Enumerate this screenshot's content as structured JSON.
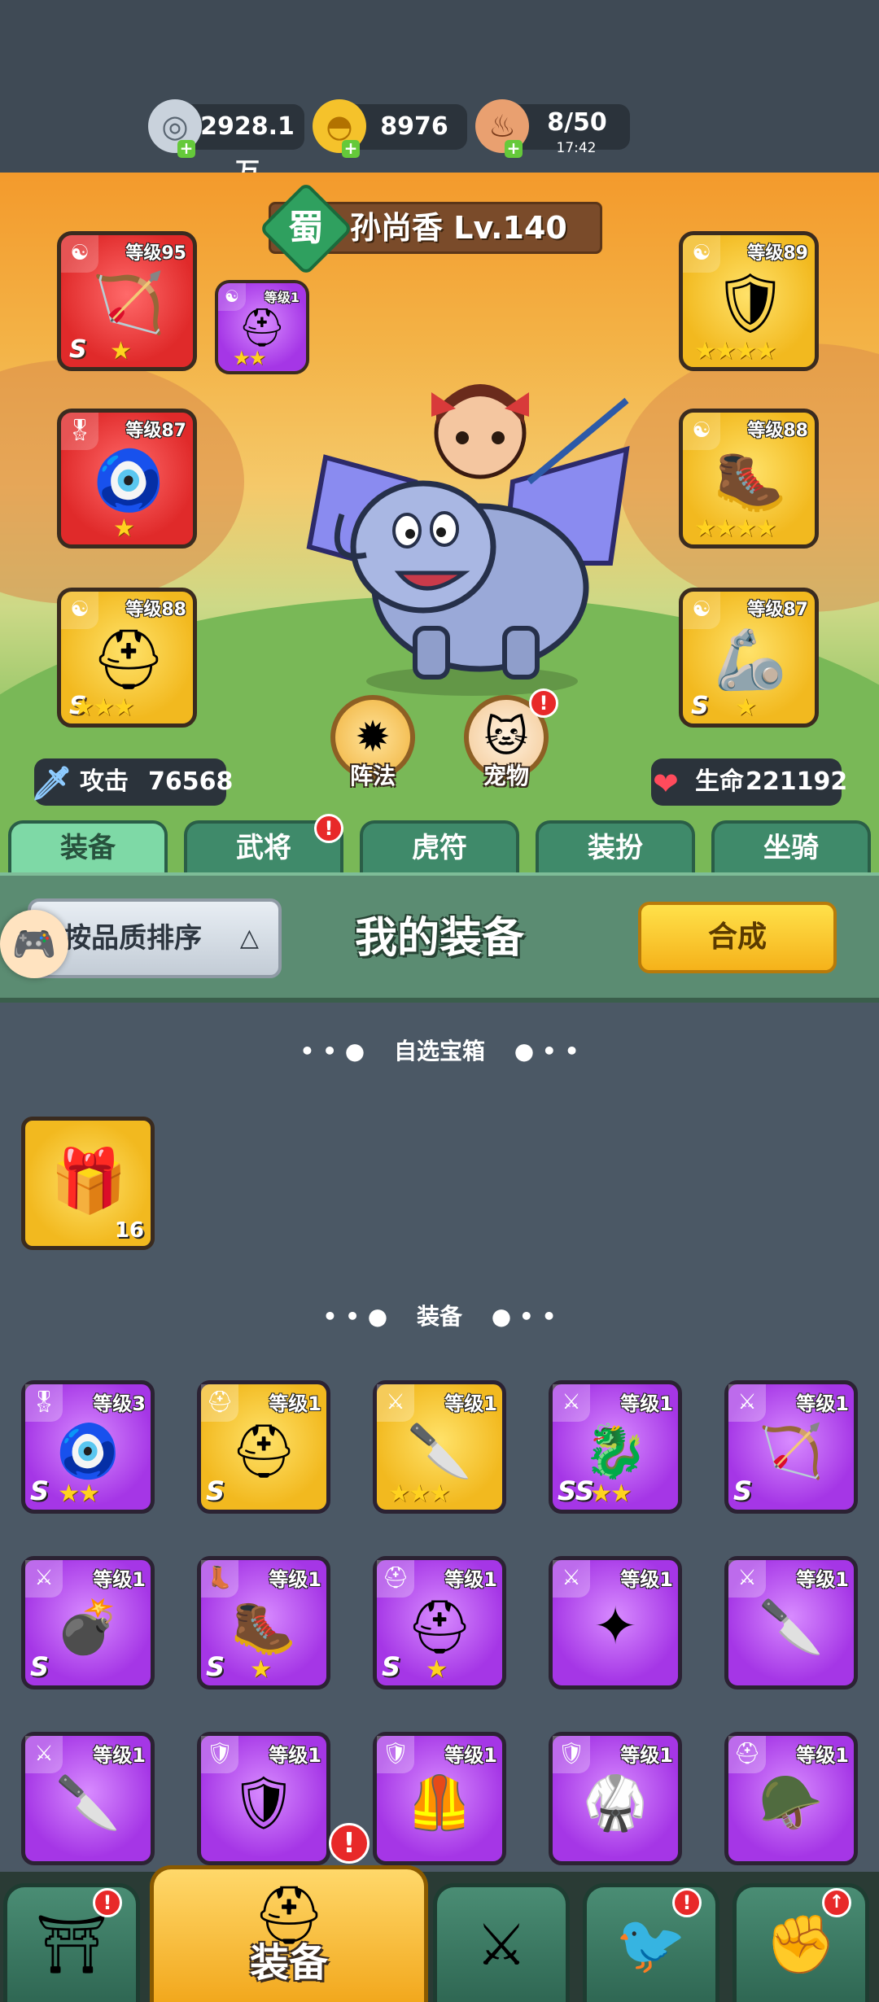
{
  "resources": {
    "silver": {
      "value": "2928.1万",
      "icon": "silver-coin-icon"
    },
    "gold": {
      "value": "8976",
      "icon": "gold-ingot-icon"
    },
    "stamina": {
      "value": "8/50",
      "timer": "17:42",
      "icon": "meat-drumstick-icon"
    }
  },
  "hero": {
    "faction": "蜀",
    "name": "孙尚香 Lv.140",
    "attack_label": "攻击",
    "attack_value": "76568",
    "hp_label": "生命",
    "hp_value": "221192",
    "formation_label": "阵法",
    "pet_label": "宠物",
    "slots": [
      {
        "level": "等级95",
        "grade": "S",
        "stars": "★"
      },
      {
        "level": "等级1",
        "grade": "",
        "stars": "★★"
      },
      {
        "level": "等级87",
        "grade": "",
        "stars": "★"
      },
      {
        "level": "等级88",
        "grade": "S",
        "stars": "★★★"
      },
      {
        "level": "等级89",
        "grade": "",
        "stars": "★★★★"
      },
      {
        "level": "等级88",
        "grade": "",
        "stars": "★★★★"
      },
      {
        "level": "等级87",
        "grade": "S",
        "stars": "★"
      }
    ]
  },
  "tabs": [
    "装备",
    "武将",
    "虎符",
    "装扮",
    "坐骑"
  ],
  "panel": {
    "sort_label": "按品质排序",
    "title": "我的装备",
    "combine_label": "合成"
  },
  "sections": {
    "chest": "自选宝箱",
    "equipment": "装备"
  },
  "chest": {
    "count": "16"
  },
  "items": [
    {
      "level": "等级3",
      "grade": "S",
      "stars": "★★"
    },
    {
      "level": "等级1",
      "grade": "S",
      "stars": ""
    },
    {
      "level": "等级1",
      "grade": "",
      "stars": "★★★"
    },
    {
      "level": "等级1",
      "grade": "SS",
      "stars": "★★"
    },
    {
      "level": "等级1",
      "grade": "S",
      "stars": ""
    },
    {
      "level": "等级1",
      "grade": "S",
      "stars": ""
    },
    {
      "level": "等级1",
      "grade": "S",
      "stars": "★"
    },
    {
      "level": "等级1",
      "grade": "S",
      "stars": "★"
    },
    {
      "level": "等级1",
      "grade": "",
      "stars": ""
    },
    {
      "level": "等级1",
      "grade": "",
      "stars": ""
    },
    {
      "level": "等级1",
      "grade": "",
      "stars": ""
    },
    {
      "level": "等级1",
      "grade": "",
      "stars": ""
    },
    {
      "level": "等级1",
      "grade": "",
      "stars": ""
    },
    {
      "level": "等级1",
      "grade": "",
      "stars": ""
    },
    {
      "level": "等级1",
      "grade": "",
      "stars": ""
    }
  ],
  "bottom_nav": {
    "active_label": "装备"
  },
  "colors": {
    "gold_frame": "#f2b91f",
    "purple_frame": "#a536e6",
    "red_frame": "#e02a2a",
    "tab_green": "#3f8a6a",
    "alert_red": "#e82929"
  }
}
